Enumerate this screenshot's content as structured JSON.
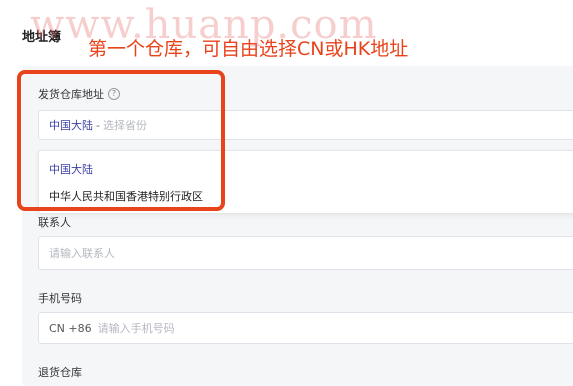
{
  "page": {
    "title": "地址簿"
  },
  "warehouse": {
    "label": "发货仓库地址",
    "help_icon": "question-circle-icon",
    "select": {
      "country": "中国大陆",
      "separator": "-",
      "province_placeholder": "选择省份"
    },
    "dropdown_options": [
      {
        "label": "中国大陆",
        "selected": true
      },
      {
        "label": "中华人民共和国香港特别行政区",
        "selected": false
      }
    ]
  },
  "contact": {
    "label": "联系人",
    "placeholder": "请输入联系人"
  },
  "phone": {
    "label": "手机号码",
    "prefix": "CN +86",
    "placeholder": "请输入手机号码"
  },
  "return_warehouse": {
    "label": "退货仓库"
  },
  "annotation": {
    "text": "第一个仓库，可自由选择CN或HK地址",
    "color": "#e8431b"
  },
  "watermark": {
    "text": "www.huanp.com"
  },
  "colors": {
    "accent": "#3b3fa3",
    "highlight": "#e8431b",
    "panel_bg": "#f5f6f8"
  }
}
